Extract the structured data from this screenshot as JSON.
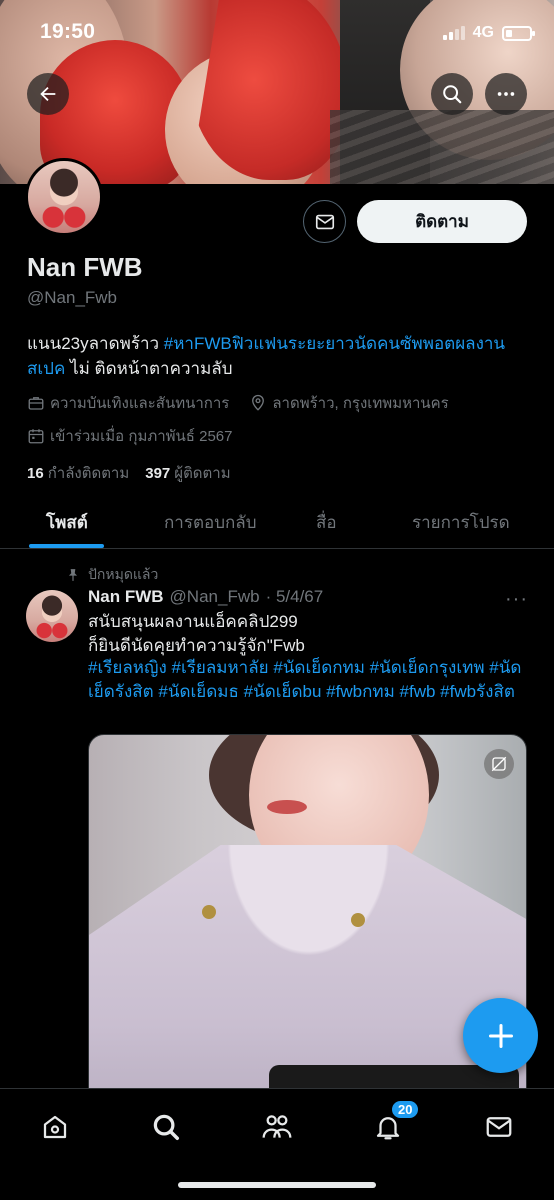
{
  "status_bar": {
    "time": "19:50",
    "network": "4G"
  },
  "profile": {
    "name": "Nan FWB",
    "handle": "@Nan_Fwb",
    "follow_label": "ติดตาม",
    "bio_prefix": "แนน23yลาดพร้าว ",
    "bio_link": "#หาFWBฟิวแฟนระยะยาวนัดคนซัพพอตผลงาน สเปค",
    "bio_suffix": " ไม่ ติดหน้าตาความลับ",
    "category": "ความบันเทิงและสันทนาการ",
    "location": "ลาดพร้าว, กรุงเทพมหานคร",
    "joined": "เข้าร่วมเมื่อ กุมภาพันธ์ 2567",
    "following_count": "16",
    "following_label": "กำลังติดตาม",
    "followers_count": "397",
    "followers_label": "ผู้ติดตาม"
  },
  "tabs": [
    {
      "label": "โพสต์",
      "active": true
    },
    {
      "label": "การตอบกลับ",
      "active": false
    },
    {
      "label": "สื่อ",
      "active": false
    },
    {
      "label": "รายการโปรด",
      "active": false
    }
  ],
  "post": {
    "pinned_label": "ปักหมุดแล้ว",
    "author_name": "Nan FWB",
    "author_handle": "@Nan_Fwb",
    "date": "· 5/4/67",
    "more": "···",
    "line1": "สนับสนุนผลงานแอ็คคลิป299",
    "line2": "ก็ยินดีนัดคุยทำความรู้จัก\"Fwb",
    "hashtags": "#เรียลหญิง #เรียลมหาลัย #นัดเย็ดกทม #นัดเย็ดกรุงเทพ #นัดเย็ดรังสิต #นัดเย็ดมธ #นัดเย็ดbu #fwbกทม #fwb #fwbรังสิต"
  },
  "bottom_nav": {
    "items": [
      "home-icon",
      "search-icon",
      "communities-icon",
      "notifications-icon",
      "messages-icon"
    ],
    "notification_count": "20"
  },
  "colors": {
    "accent": "#1d9bf0",
    "background": "#000000",
    "text": "#e7e9ea",
    "muted": "#71767b"
  }
}
